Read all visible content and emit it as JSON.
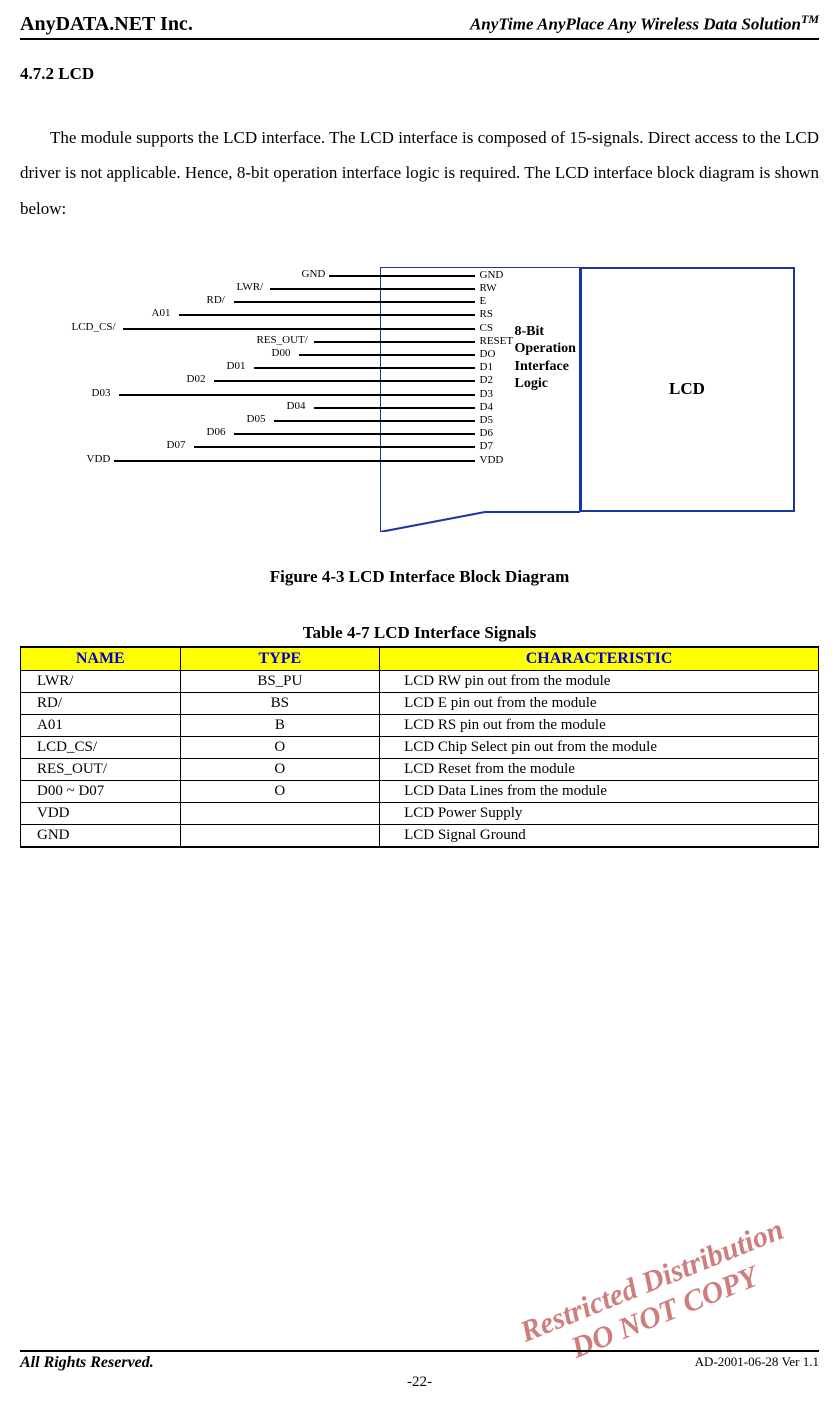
{
  "header": {
    "left": "AnyDATA.NET Inc.",
    "right": "AnyTime AnyPlace Any Wireless Data Solution",
    "right_sup": "TM"
  },
  "section_heading": "4.7.2 LCD",
  "body_paragraph": "The module supports the LCD interface. The LCD interface is composed of 15-signals. Direct access to the LCD driver is not applicable. Hence, 8-bit operation interface logic is required. The LCD interface block diagram is shown below:",
  "diagram": {
    "lcd_label": "LCD",
    "logic_l1": "8-Bit",
    "logic_l2": "Operation",
    "logic_l3": "Interface",
    "logic_l4": "Logic",
    "signals": [
      "GND",
      "LWR/",
      "RD/",
      "A01",
      "LCD_CS/",
      "RES_OUT/",
      "D00",
      "D01",
      "D02",
      "D03",
      "D04",
      "D05",
      "D06",
      "D07",
      "VDD"
    ],
    "pins": [
      "GND",
      "RW",
      "E",
      "RS",
      "CS",
      "RESET",
      "DO",
      "D1",
      "D2",
      "D3",
      "D4",
      "D5",
      "D6",
      "D7",
      "VDD"
    ]
  },
  "figure_caption": "Figure 4-3 LCD Interface Block Diagram",
  "table_caption": "Table 4-7 LCD Interface Signals",
  "table": {
    "headers": [
      "NAME",
      "TYPE",
      "CHARACTERISTIC"
    ],
    "rows": [
      {
        "name": "LWR/",
        "type": "BS_PU",
        "char": "LCD RW pin out from the module"
      },
      {
        "name": "RD/",
        "type": "BS",
        "char": "LCD E pin out from the module"
      },
      {
        "name": "A01",
        "type": "B",
        "char": "LCD RS pin out from the module"
      },
      {
        "name": "LCD_CS/",
        "type": "O",
        "char": "LCD Chip Select pin out from the module"
      },
      {
        "name": "RES_OUT/",
        "type": "O",
        "char": "LCD Reset from the module"
      },
      {
        "name": "D00 ~ D07",
        "type": "O",
        "char": "LCD Data Lines from the module"
      },
      {
        "name": "VDD",
        "type": "",
        "char": "LCD Power Supply"
      },
      {
        "name": "GND",
        "type": "",
        "char": "LCD Signal Ground"
      }
    ]
  },
  "watermark": {
    "line1": "Restricted Distribution",
    "line2": "DO NOT COPY"
  },
  "footer": {
    "left": "All Rights Reserved.",
    "right": "AD-2001-06-28 Ver 1.1",
    "page": "-22-"
  }
}
